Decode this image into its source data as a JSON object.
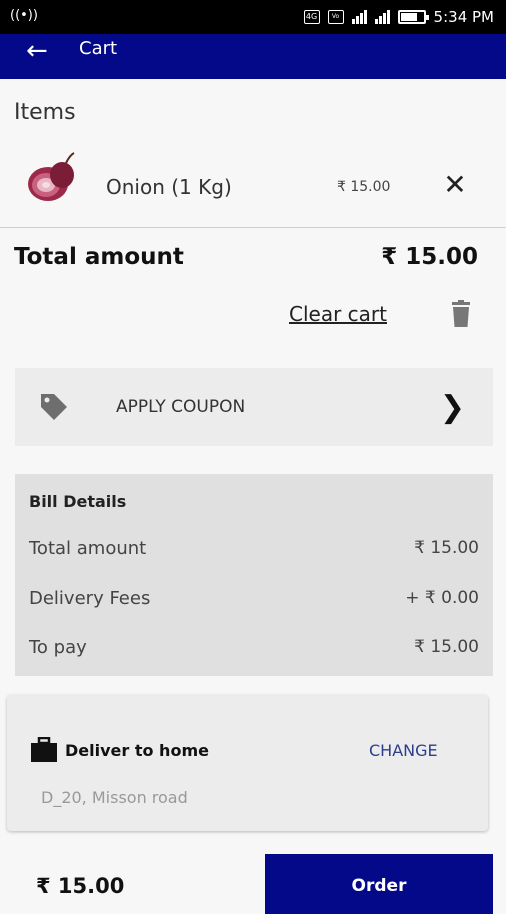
{
  "status_bar": {
    "time": "5:34 PM",
    "network": "VO) LTE1",
    "signal": "4G"
  },
  "app_bar": {
    "title": "Cart"
  },
  "items_section": {
    "label": "Items"
  },
  "cart_items": [
    {
      "name": "Onion  (1 Kg)",
      "price": "₹ 15.00",
      "remove_icon": "close-icon"
    }
  ],
  "totals": {
    "label": "Total amount",
    "value": "₹ 15.00"
  },
  "clear_cart": {
    "label": "Clear cart"
  },
  "coupon": {
    "label": "APPLY COUPON"
  },
  "bill": {
    "heading": "Bill Details",
    "rows": [
      {
        "label": "Total amount",
        "value": "₹ 15.00"
      },
      {
        "label": "Delivery Fees",
        "value": "+ ₹ 0.00"
      },
      {
        "label": "To pay",
        "value": "₹ 15.00"
      }
    ]
  },
  "delivery": {
    "title": "Deliver to home",
    "change_label": "CHANGE",
    "address": "D_20, Misson road"
  },
  "footer": {
    "price": "₹ 15.00",
    "order_label": "Order"
  },
  "colors": {
    "primary": "#04098a",
    "link": "#2c3e8c"
  }
}
